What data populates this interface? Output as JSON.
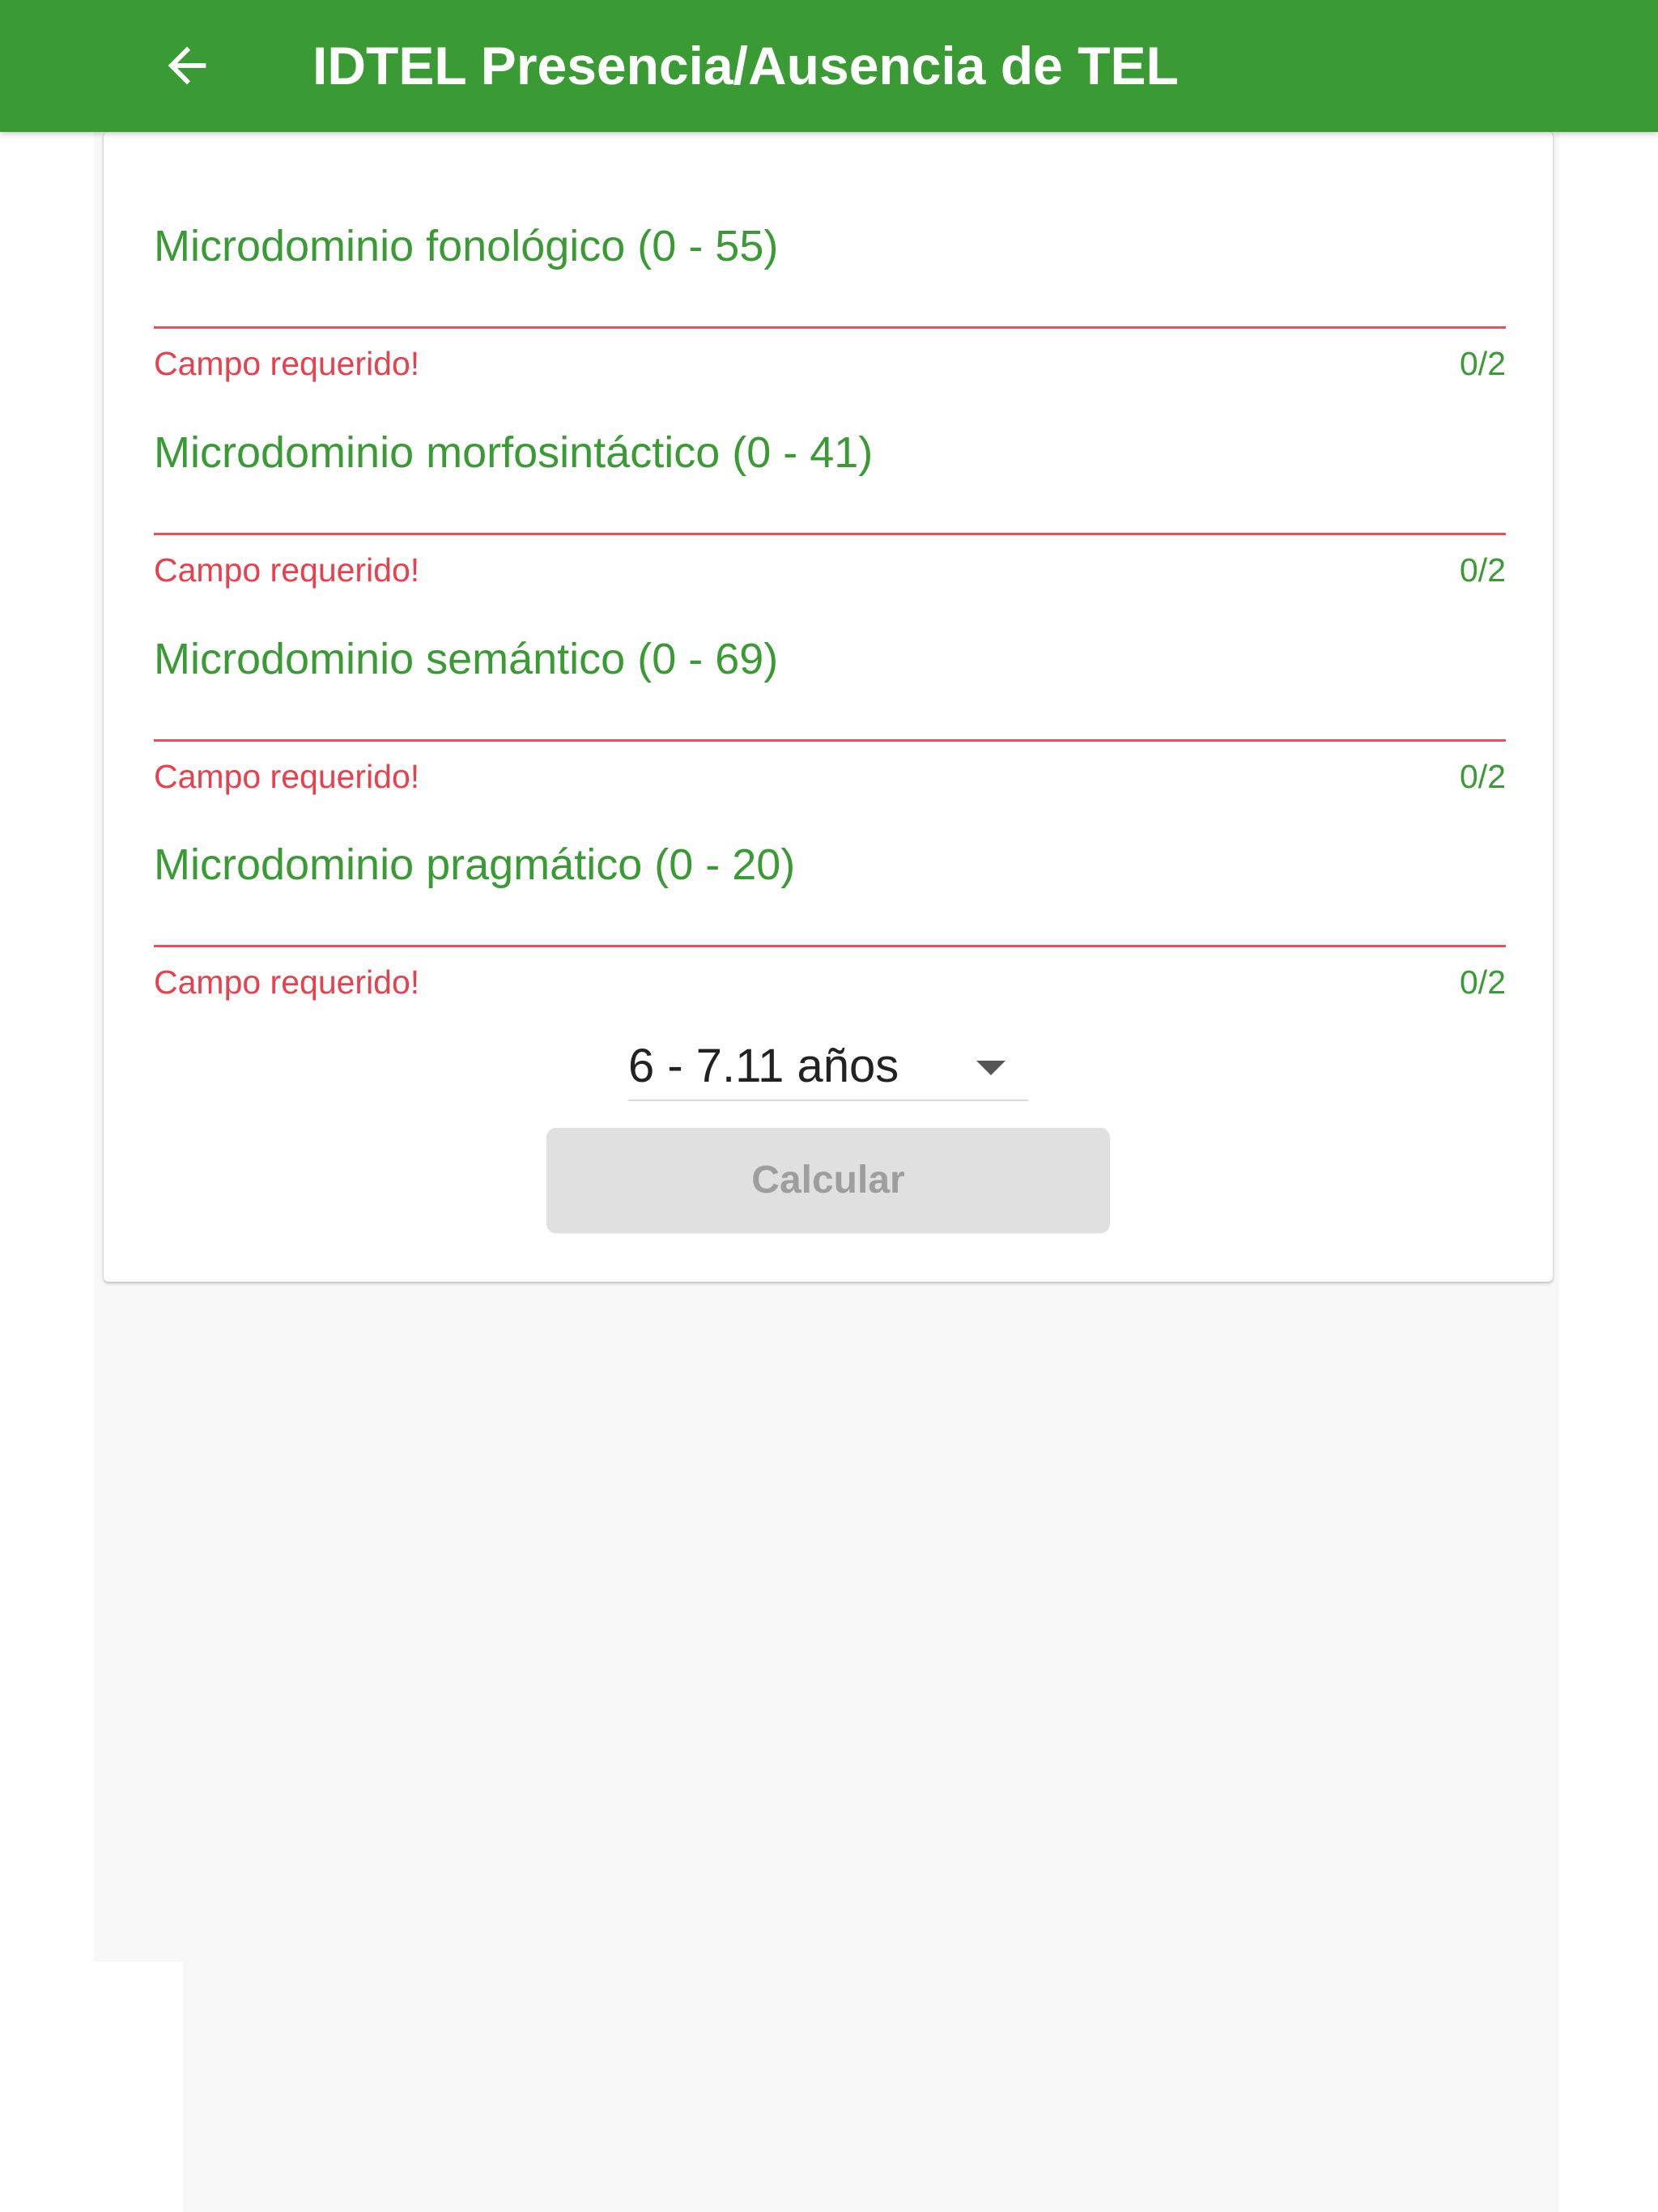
{
  "app_bar": {
    "title": "IDTEL Presencia/Ausencia de TEL",
    "back_icon": "arrow-left-icon"
  },
  "form": {
    "fields": [
      {
        "label": "Microdominio fonológico (0 - 55)",
        "value": "",
        "error": "Campo requerido!",
        "counter": "0/2"
      },
      {
        "label": "Microdominio morfosintáctico (0 - 41)",
        "value": "",
        "error": "Campo requerido!",
        "counter": "0/2"
      },
      {
        "label": "Microdominio semántico (0 - 69)",
        "value": "",
        "error": "Campo requerido!",
        "counter": "0/2"
      },
      {
        "label": "Microdominio pragmático (0 - 20)",
        "value": "",
        "error": "Campo requerido!",
        "counter": "0/2"
      }
    ],
    "age_select": {
      "selected": "6 - 7.11 años",
      "icon": "caret-down-icon"
    },
    "calculate_button": {
      "label": "Calcular",
      "disabled": true
    }
  },
  "colors": {
    "primary": "#3a9b34",
    "error": "#e8404c",
    "disabled_button": "#e0e0e0",
    "background": "#f8f8f8"
  }
}
